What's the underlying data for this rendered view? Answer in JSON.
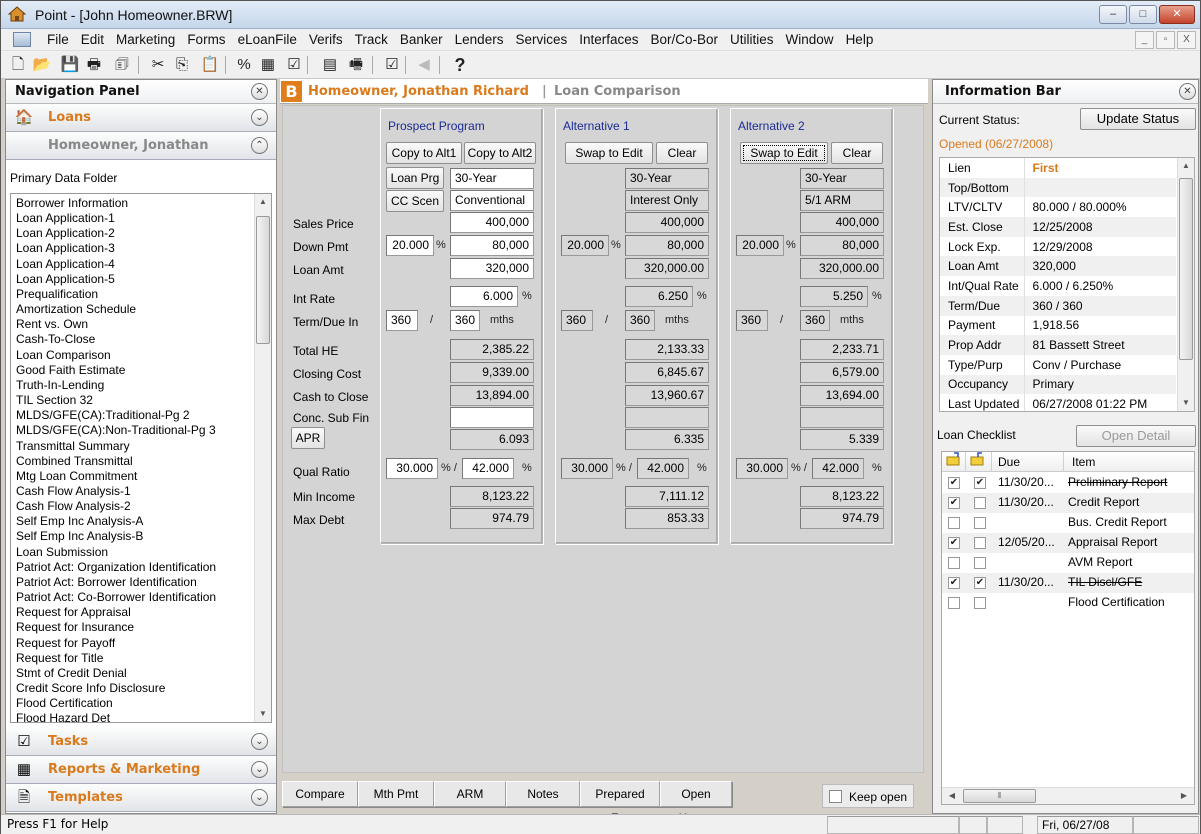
{
  "window": {
    "title": "Point - [John Homeowner.BRW]",
    "controls": {
      "minimize": "–",
      "maximize": "□",
      "close": "✕"
    },
    "mdi_controls": {
      "minimize": "_",
      "restore": "▫",
      "close": "X"
    }
  },
  "menu": [
    "File",
    "Edit",
    "Marketing",
    "Forms",
    "eLoanFile",
    "Verifs",
    "Track",
    "Banker",
    "Lenders",
    "Services",
    "Interfaces",
    "Bor/Co-Bor",
    "Utilities",
    "Window",
    "Help"
  ],
  "toolbar": [
    {
      "name": "new-file-icon",
      "glyph": "🗋"
    },
    {
      "name": "open-folder-icon",
      "glyph": "📂"
    },
    {
      "name": "save-icon",
      "glyph": "💾"
    },
    {
      "name": "print-icon",
      "glyph": "🖶"
    },
    {
      "name": "print-preview-icon",
      "glyph": "🗊"
    },
    {
      "name": "cut-icon",
      "glyph": "✂"
    },
    {
      "name": "copy-icon",
      "glyph": "⎘"
    },
    {
      "name": "paste-icon",
      "glyph": "📋"
    },
    {
      "name": "percent-icon",
      "glyph": "%"
    },
    {
      "name": "calculator-icon",
      "glyph": "▦"
    },
    {
      "name": "checklist-clipboard-icon",
      "glyph": "☑"
    },
    {
      "name": "calendar-icon",
      "glyph": "▤"
    },
    {
      "name": "fax-icon",
      "glyph": "🖷"
    },
    {
      "name": "task-icon",
      "glyph": "☑"
    },
    {
      "name": "back-arrow-icon",
      "glyph": "◀"
    },
    {
      "name": "help-icon",
      "glyph": "?"
    }
  ],
  "nav": {
    "title": "Navigation Panel",
    "close_glyph": "✕",
    "collapse_glyph": "⌄",
    "expand_glyph": "⌃",
    "loans_label": "Loans",
    "borrower_label": "Homeowner, Jonathan",
    "folder_label": "Primary Data Folder",
    "documents": [
      "Borrower Information",
      "Loan Application-1",
      "Loan Application-2",
      "Loan Application-3",
      "Loan Application-4",
      "Loan Application-5",
      "Prequalification",
      "Amortization Schedule",
      "Rent vs. Own",
      "Cash-To-Close",
      "Loan Comparison",
      "Good Faith Estimate",
      "Truth-In-Lending",
      "TIL Section 32",
      "MLDS/GFE(CA):Traditional-Pg 2",
      "MLDS/GFE(CA):Non-Traditional-Pg 3",
      "Transmittal Summary",
      "Combined Transmittal",
      "Mtg Loan Commitment",
      "Cash Flow Analysis-1",
      "Cash Flow Analysis-2",
      "Self Emp Inc Analysis-A",
      "Self Emp Inc Analysis-B",
      "Loan Submission",
      "Patriot Act: Organization Identification",
      "Patriot Act: Borrower Identification",
      "Patriot Act: Co-Borrower Identification",
      "Request for Appraisal",
      "Request for Insurance",
      "Request for Payoff",
      "Request for Title",
      "Stmt of Credit Denial",
      "Credit Score Info Disclosure",
      "Flood Certification",
      "Flood Hazard Det"
    ],
    "sections": [
      {
        "label": "Tasks",
        "icon": "☑"
      },
      {
        "label": "Reports & Marketing",
        "icon": "▦"
      },
      {
        "label": "Templates",
        "icon": "🗎"
      }
    ]
  },
  "main": {
    "badge": "B",
    "borrower": "Homeowner, Jonathan Richard",
    "separator": "|",
    "screen": "Loan Comparison",
    "row_labels": {
      "sales_price": "Sales Price",
      "down_pmt": "Down Pmt",
      "loan_amt": "Loan Amt",
      "int_rate": "Int Rate",
      "term_due": "Term/Due In",
      "total_he": "Total HE",
      "closing_cost": "Closing Cost",
      "cash_to_close": "Cash to Close",
      "conc_sub_fin": "Conc. Sub Fin",
      "apr": "APR",
      "qual_ratio": "Qual Ratio",
      "min_income": "Min Income",
      "max_debt": "Max Debt"
    },
    "units": {
      "pct": "%",
      "slash": "/",
      "mths": "mths",
      "pct_slash": "% /"
    },
    "prospect": {
      "title": "Prospect Program",
      "btn1": "Copy to Alt1",
      "btn2": "Copy to Alt2",
      "loan_prg_btn": "Loan Prg",
      "cc_scen_btn": "CC Scen",
      "loan_prg": "30-Year",
      "cc_scen": "Conventional",
      "sales_price": "400,000",
      "down_pct": "20.000",
      "down_amt": "80,000",
      "loan_amt": "320,000",
      "int_rate": "6.000",
      "term": "360",
      "due": "360",
      "total_he": "2,385.22",
      "closing_cost": "9,339.00",
      "cash_to_close": "13,894.00",
      "conc_sub_fin": "",
      "apr": "6.093",
      "qual1": "30.000",
      "qual2": "42.000",
      "min_income": "8,123.22",
      "max_debt": "974.79"
    },
    "alt1": {
      "title": "Alternative 1",
      "btn1": "Swap to Edit",
      "btn2": "Clear",
      "loan_prg": "30-Year",
      "cc_scen": "Interest Only",
      "sales_price": "400,000",
      "down_pct": "20.000",
      "down_amt": "80,000",
      "loan_amt": "320,000.00",
      "int_rate": "6.250",
      "term": "360",
      "due": "360",
      "total_he": "2,133.33",
      "closing_cost": "6,845.67",
      "cash_to_close": "13,960.67",
      "conc_sub_fin": "",
      "apr": "6.335",
      "qual1": "30.000",
      "qual2": "42.000",
      "min_income": "7,111.12",
      "max_debt": "853.33"
    },
    "alt2": {
      "title": "Alternative 2",
      "btn1": "Swap to Edit",
      "btn2": "Clear",
      "loan_prg": "30-Year",
      "cc_scen": "5/1 ARM",
      "sales_price": "400,000",
      "down_pct": "20.000",
      "down_amt": "80,000",
      "loan_amt": "320,000.00",
      "int_rate": "5.250",
      "term": "360",
      "due": "360",
      "total_he": "2,233.71",
      "closing_cost": "6,579.00",
      "cash_to_close": "13,694.00",
      "conc_sub_fin": "",
      "apr": "5.339",
      "qual1": "30.000",
      "qual2": "42.000",
      "min_income": "8,123.22",
      "max_debt": "974.79"
    },
    "tabs": [
      "Compare",
      "Mth Pmt",
      "ARM",
      "Notes",
      "Prepared For",
      "Open House"
    ],
    "keep_open": "Keep open",
    "keep_open_checked": false
  },
  "info": {
    "title": "Information Bar",
    "status_label": "Current Status:",
    "update_btn": "Update Status",
    "status_value": "Opened (06/27/2008)",
    "fields": [
      {
        "k": "Lien",
        "v": "First"
      },
      {
        "k": "Top/Bottom",
        "v": ""
      },
      {
        "k": "LTV/CLTV",
        "v": "80.000 / 80.000%"
      },
      {
        "k": "Est. Close",
        "v": "12/25/2008"
      },
      {
        "k": "Lock Exp.",
        "v": "12/29/2008"
      },
      {
        "k": "Loan Amt",
        "v": "320,000"
      },
      {
        "k": "Int/Qual Rate",
        "v": "6.000 / 6.250%"
      },
      {
        "k": "Term/Due",
        "v": "360 / 360"
      },
      {
        "k": "Payment",
        "v": "1,918.56"
      },
      {
        "k": "Prop Addr",
        "v": "81 Bassett Street"
      },
      {
        "k": "Type/Purp",
        "v": "Conv / Purchase"
      },
      {
        "k": "Occupancy",
        "v": "Primary"
      },
      {
        "k": "Last Updated",
        "v": "06/27/2008 01:22 PM"
      }
    ],
    "checklist_label": "Loan Checklist",
    "open_detail_btn": "Open Detail",
    "checklist_headers": {
      "due": "Due",
      "item": "Item"
    },
    "checklist": [
      {
        "c1": true,
        "c2": true,
        "due": "11/30/20...",
        "item": "Preliminary Report",
        "done": true
      },
      {
        "c1": true,
        "c2": false,
        "due": "11/30/20...",
        "item": "Credit Report",
        "done": false
      },
      {
        "c1": false,
        "c2": false,
        "due": "",
        "item": "Bus. Credit Report",
        "done": false
      },
      {
        "c1": true,
        "c2": false,
        "due": "12/05/20...",
        "item": "Appraisal Report",
        "done": false
      },
      {
        "c1": false,
        "c2": false,
        "due": "",
        "item": "AVM Report",
        "done": false
      },
      {
        "c1": true,
        "c2": true,
        "due": "11/30/20...",
        "item": "TIL Discl/GFE",
        "done": true
      },
      {
        "c1": false,
        "c2": false,
        "due": "",
        "item": "Flood Certification",
        "done": false
      }
    ]
  },
  "statusbar": {
    "help": "Press F1 for Help",
    "date": "Fri, 06/27/08"
  }
}
